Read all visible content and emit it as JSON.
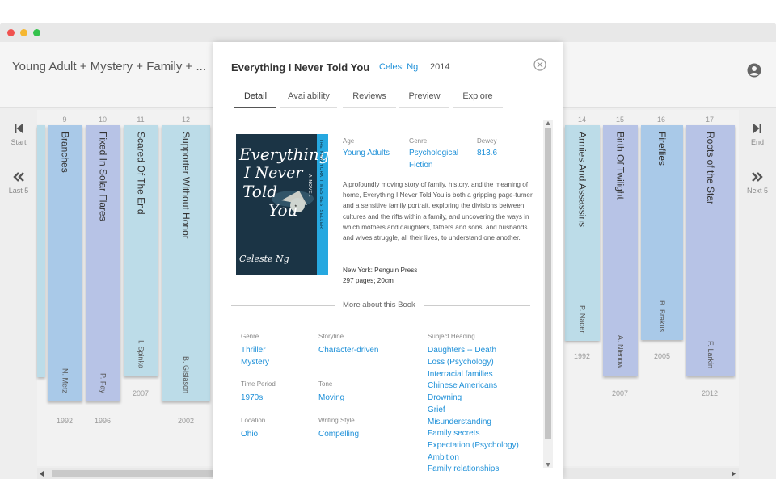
{
  "header": {
    "title": "Young Adult + Mystery + Family + ..."
  },
  "controls": {
    "start_label": "Start",
    "last5_label": "Last 5",
    "end_label": "End",
    "next5_label": "Next 5"
  },
  "shelf": {
    "left_books": [
      {
        "num": "9",
        "title": "Branches",
        "author": "N. Metz",
        "year": "1992",
        "color": "#a9c9e8"
      },
      {
        "num": "10",
        "title": "Fixed In Solar Flares",
        "author": "P. Fay",
        "year": "1996",
        "color": "#b7c3e6"
      },
      {
        "num": "11",
        "title": "Scared Of The End",
        "author": "I. Spinka",
        "year": "2007",
        "color": "#bcdce8"
      },
      {
        "num": "12",
        "title": "Supporter Without Honor",
        "author": "B. Gislason",
        "year": "2002",
        "color": "#bcdce8"
      }
    ],
    "right_books": [
      {
        "num": "14",
        "title": "Armies And Assassins",
        "author": "P. Nader",
        "year": "1992",
        "color": "#bcdce8"
      },
      {
        "num": "15",
        "title": "Birth Of Twilight",
        "author": "A. Nienow",
        "year": "2007",
        "color": "#b7c3e6"
      },
      {
        "num": "16",
        "title": "Fireflies",
        "author": "B. Brakus",
        "year": "2005",
        "color": "#a9c9e8"
      },
      {
        "num": "17",
        "title": "Roots of the Star",
        "author": "F. Larkin",
        "year": "2012",
        "color": "#b7c3e6"
      }
    ]
  },
  "book": {
    "title": "Everything I Never Told You",
    "author": "Celest Ng",
    "year": "2014",
    "tabs": [
      "Detail",
      "Availability",
      "Reviews",
      "Preview",
      "Explore"
    ],
    "active_tab": "Detail",
    "cover": {
      "title_line1": "Everything",
      "title_line2": "I Never",
      "title_line3": "Told",
      "title_line4": "You",
      "author": "Celeste Ng",
      "side_text": "THE NEW YORK TIMES BESTSELLER",
      "novel": "A NOVEL"
    },
    "age_label": "Age",
    "age_value": "Young Adults",
    "genre_label": "Genre",
    "genre_value_1": "Psychological",
    "genre_value_2": "Fiction",
    "dewey_label": "Dewey",
    "dewey_value": "813.6",
    "description": "A profoundly moving story of family, history, and the meaning of home, Everything I Never Told You is both a gripping page-turner and a sensitive family portrait, exploring the divisions between cultures and the rifts within a family, and uncovering the ways in which mothers and daughters, fathers and sons, and husbands and wives struggle, all their lives, to understand one another.",
    "publisher": "New York: Penguin Press",
    "pages": "297 pages; 20cm",
    "more_label": "More about this Book",
    "more": {
      "genre_label": "Genre",
      "genre_values": [
        "Thriller",
        "Mystery"
      ],
      "storyline_label": "Storyline",
      "storyline_value": "Character-driven",
      "subject_label": "Subject Heading",
      "subject_values": [
        "Daughters -- Death",
        "Loss (Psychology)",
        "Interracial families",
        "Chinese Americans",
        "Drowning",
        "Grief",
        "Misunderstanding",
        "Family secrets",
        "Expectation (Psychology)",
        "Ambition",
        "Family relationships"
      ],
      "period_label": "Time Period",
      "period_value": "1970s",
      "tone_label": "Tone",
      "tone_value": "Moving",
      "location_label": "Location",
      "location_value": "Ohio",
      "style_label": "Writing Style",
      "style_value": "Compelling"
    }
  },
  "colors": {
    "link": "#1e90d8",
    "spine_blue": "#a9c9e8",
    "spine_periwinkle": "#b7c3e6",
    "spine_light": "#bcdce8"
  }
}
